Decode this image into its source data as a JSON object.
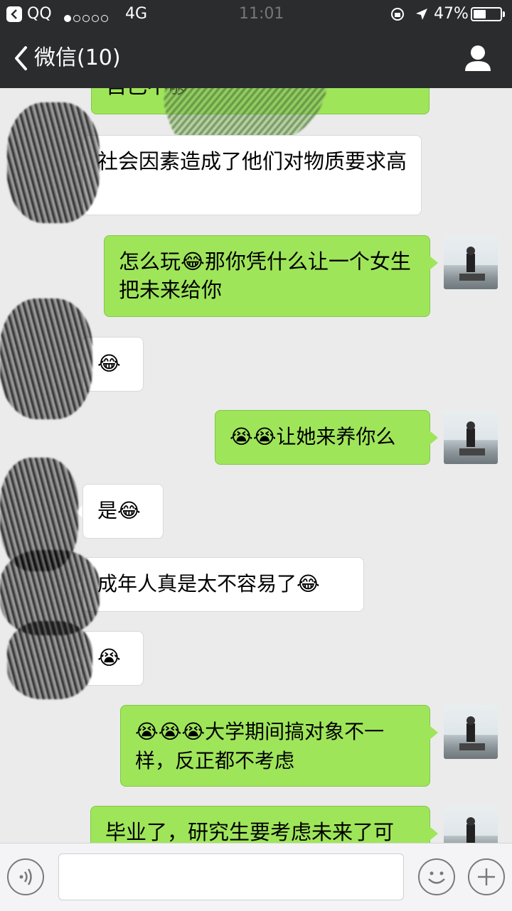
{
  "status_bar": {
    "back_app_label": "QQ",
    "signal_dots_filled": 1,
    "signal_dots_total": 5,
    "network": "4G",
    "time": "11:01",
    "battery_percent": "47%",
    "battery_level": 0.47
  },
  "nav": {
    "title": "微信(10)",
    "back_icon": "chevron-left-icon",
    "profile_icon": "person-icon"
  },
  "messages": [
    {
      "side": "out",
      "text": "自己不够",
      "partial": true
    },
    {
      "side": "in",
      "text": "社会因素造成了他们对物质要求高"
    },
    {
      "side": "out",
      "text": "怎么玩😂那你凭什么让一个女生把未来给你"
    },
    {
      "side": "in",
      "text": "😂"
    },
    {
      "side": "out",
      "text": "😭😭让她来养你么"
    },
    {
      "side": "in",
      "text": "是😂"
    },
    {
      "side": "in",
      "text": "成年人真是太不容易了😂"
    },
    {
      "side": "in",
      "text": "😭"
    },
    {
      "side": "out",
      "text": "😭😭😭大学期间搞对象不一样，反正都不考虑"
    },
    {
      "side": "out",
      "text": "毕业了，研究生要考虑未来了可",
      "partial": true
    }
  ],
  "input_bar": {
    "voice_icon": "voice-icon",
    "emoji_icon": "smiley-icon",
    "add_icon": "plus-icon",
    "input_value": ""
  },
  "colors": {
    "bar_bg": "#2b2c2e",
    "chat_bg": "#ebebeb",
    "out_bubble": "#9fe55a",
    "in_bubble": "#ffffff"
  }
}
